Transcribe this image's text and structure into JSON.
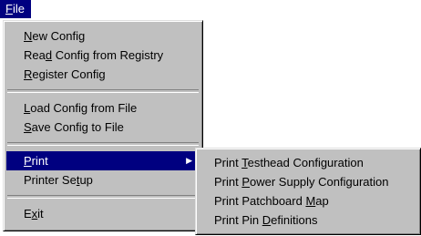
{
  "menubar": {
    "file": {
      "before": "",
      "accel": "F",
      "after": "ile"
    }
  },
  "file_menu": {
    "new_config": {
      "before": "",
      "accel": "N",
      "after": "ew Config"
    },
    "read_config": {
      "before": "Rea",
      "accel": "d",
      "after": " Config from Registry"
    },
    "register_config": {
      "before": "",
      "accel": "R",
      "after": "egister Config"
    },
    "load_config": {
      "before": "",
      "accel": "L",
      "after": "oad Config from File"
    },
    "save_config": {
      "before": "",
      "accel": "S",
      "after": "ave Config to File"
    },
    "print": {
      "before": "",
      "accel": "P",
      "after": "rint"
    },
    "printer_setup": {
      "before": "Printer Se",
      "accel": "t",
      "after": "up"
    },
    "exit": {
      "before": "E",
      "accel": "x",
      "after": "it"
    }
  },
  "print_submenu": {
    "testhead": {
      "before": "Print ",
      "accel": "T",
      "after": "esthead Configuration"
    },
    "power_supply": {
      "before": "Print ",
      "accel": "P",
      "after": "ower Supply Configuration"
    },
    "patchboard": {
      "before": "Print Patchboard ",
      "accel": "M",
      "after": "ap"
    },
    "pin_definitions": {
      "before": "Print Pin ",
      "accel": "D",
      "after": "efinitions"
    }
  },
  "icons": {
    "submenu_arrow": "triangle-right"
  }
}
